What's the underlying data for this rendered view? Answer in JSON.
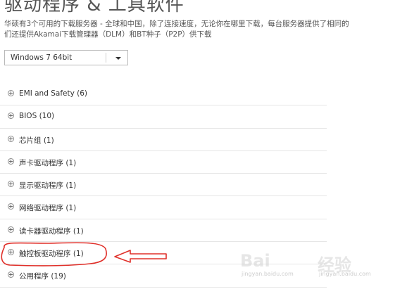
{
  "page": {
    "title": "驱动程序 & 工具软件",
    "intro_line1": "华硕有3个可用的下载服务器 - 全球和中国，除了连接速度，无论你在哪里下载，每台服务器提供了相同的",
    "intro_line2": "们还提供Akamai下载管理器（DLM）和BT种子（P2P）供下载"
  },
  "os_select": {
    "value": "Windows 7 64bit"
  },
  "categories": [
    {
      "label": "EMI and Safety  (6)"
    },
    {
      "label": "BIOS (10)"
    },
    {
      "label": "芯片组 (1)"
    },
    {
      "label": "声卡驱动程序 (1)"
    },
    {
      "label": "显示驱动程序 (1)"
    },
    {
      "label": "网络驱动程序 (1)"
    },
    {
      "label": "读卡器驱动程序 (1)"
    },
    {
      "label": "触控板驱动程序 (1)"
    },
    {
      "label": "公用程序 (19)"
    }
  ],
  "annotation": {
    "color": "#e0302a",
    "highlighted_item": "触控板驱动程序 (1)"
  },
  "watermark": {
    "logo_left": "Bai",
    "logo_right": "经验",
    "url_left": "jingyan.baidu.com",
    "url_right": "jingyan.baidu.com"
  }
}
